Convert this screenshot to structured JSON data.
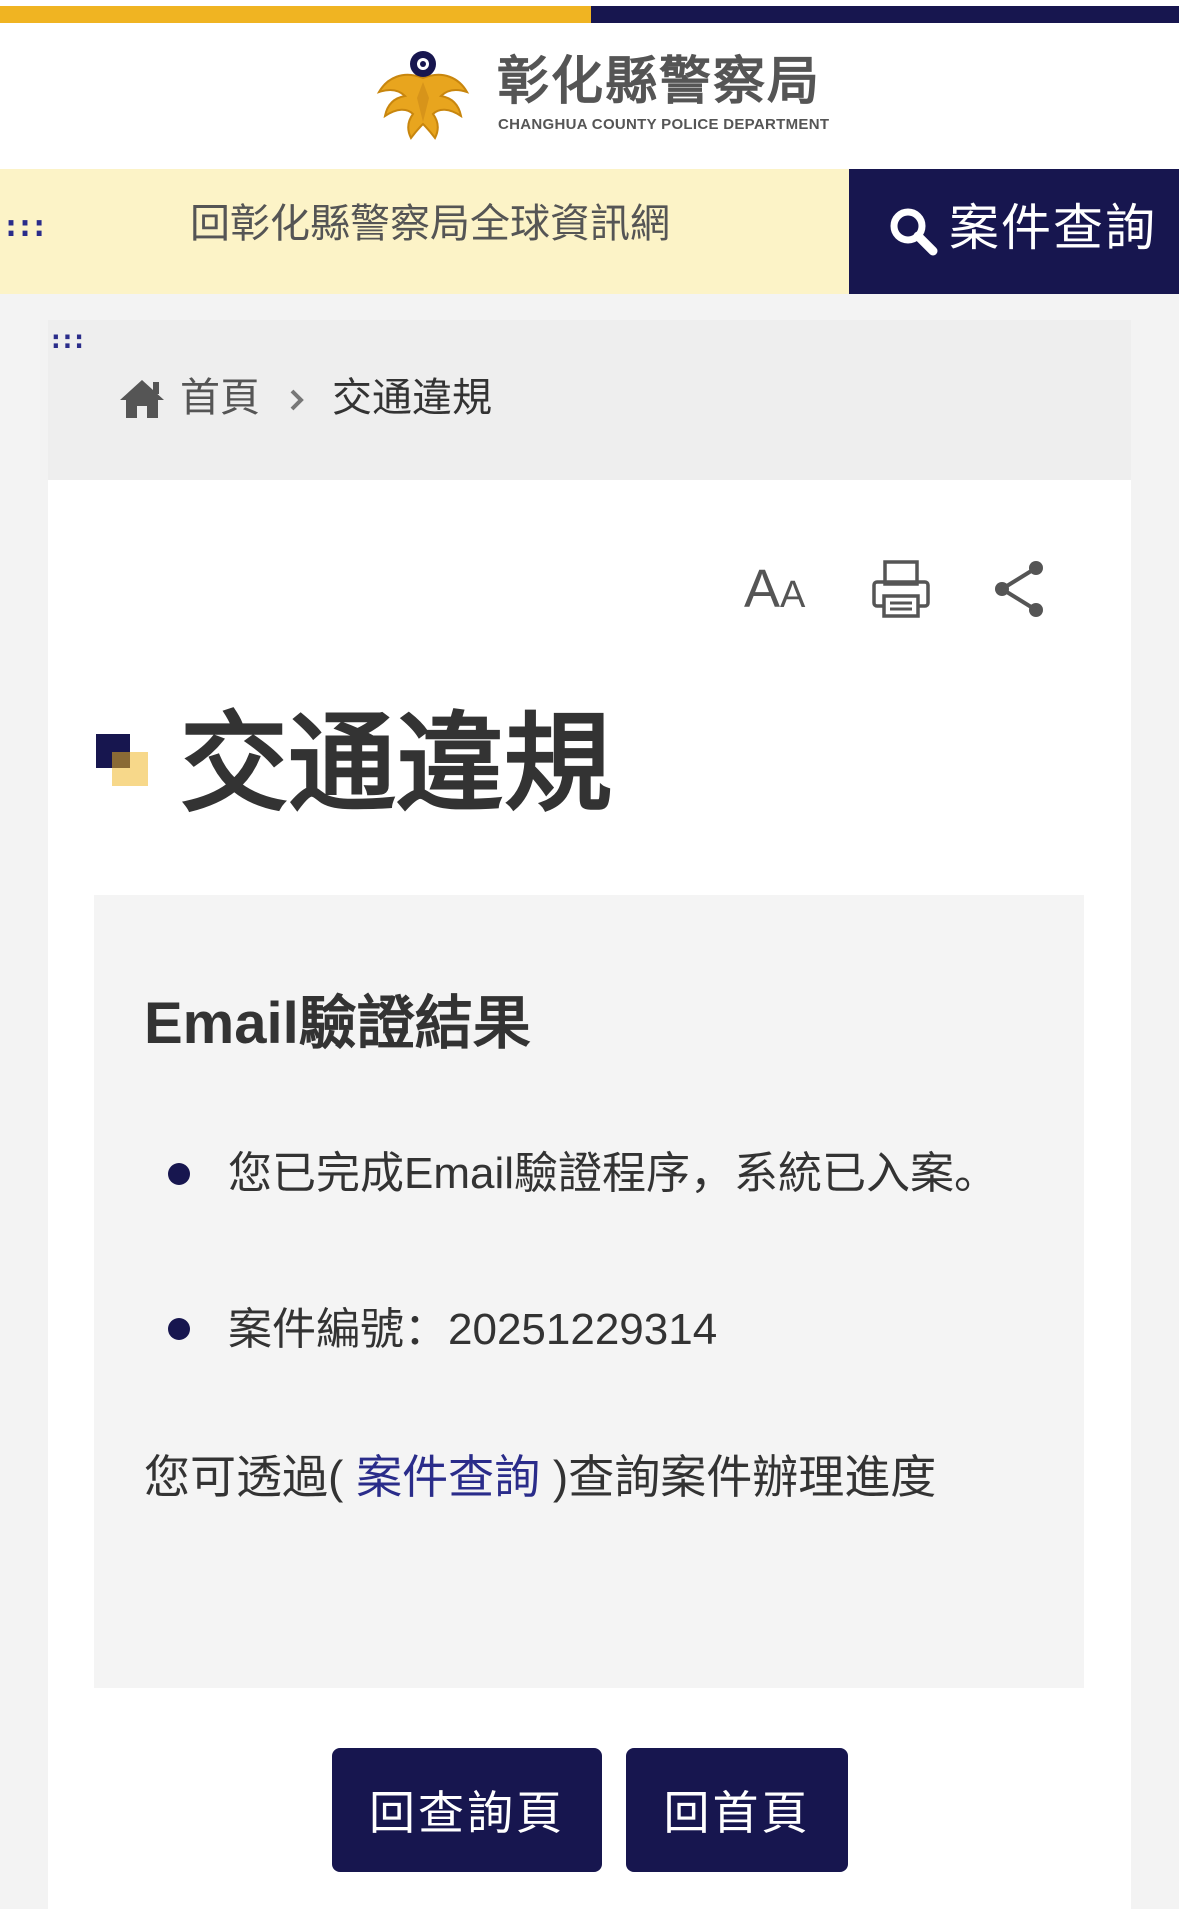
{
  "header": {
    "title": "彰化縣警察局",
    "subtitle": "CHANGHUA COUNTY POLICE DEPARTMENT"
  },
  "nav": {
    "access_key": ":::",
    "back_link": "回彰化縣警察局全球資訊網",
    "case_query_button": "案件查詢"
  },
  "breadcrumb": {
    "access_key": ":::",
    "home": "首頁",
    "current": "交通違規"
  },
  "tools": {
    "font_size_big": "A",
    "font_size_small": "A"
  },
  "page": {
    "title": "交通違規"
  },
  "result": {
    "title": "Email驗證結果",
    "items": [
      "您已完成Email驗證程序，系統已入案。",
      "案件編號：20251229314"
    ],
    "note_prefix": "您可透過( ",
    "note_link": "案件查詢",
    "note_suffix": " )查詢案件辦理進度"
  },
  "buttons": {
    "back_to_query": "回查詢頁",
    "back_to_home": "回首頁"
  },
  "colors": {
    "navy": "#17164f",
    "gold": "#f0b422",
    "cream": "#fcf3c7",
    "link": "#2a2c8a"
  }
}
